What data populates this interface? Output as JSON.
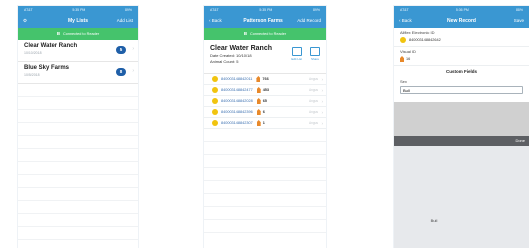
{
  "screen1": {
    "status": {
      "carrier": "AT&T",
      "time": "5:35 PM",
      "battery": "89%"
    },
    "nav": {
      "title": "My Lists",
      "right": "Add List"
    },
    "reader": "Connected to Reader",
    "lists": [
      {
        "name": "Clear Water Ranch",
        "date": "10/10/2018",
        "count": "5"
      },
      {
        "name": "Blue Sky Farms",
        "date": "10/5/2018",
        "count": "8"
      }
    ]
  },
  "screen2": {
    "status": {
      "carrier": "AT&T",
      "time": "5:35 PM",
      "battery": "89%"
    },
    "nav": {
      "left": "Back",
      "title": "Patterson Farms",
      "right": "Add Record"
    },
    "reader": "Connected to Reader",
    "farm": {
      "name": "Clear Water Ranch",
      "date_created": "Date Created: 10/10/18",
      "animal_count": "Animal Count: 5"
    },
    "actions": {
      "edit": "Edit List",
      "share": "Share"
    },
    "records": [
      {
        "eid": "840003148842011",
        "visual": "766",
        "right": "Angus"
      },
      {
        "eid": "840003148842477",
        "visual": "453",
        "right": "Angus"
      },
      {
        "eid": "840003148842028",
        "visual": "65",
        "right": "Angus"
      },
      {
        "eid": "840003148842396",
        "visual": "6",
        "right": "Angus"
      },
      {
        "eid": "840003148842307",
        "visual": "1",
        "right": "Angus"
      }
    ]
  },
  "screen3": {
    "status": {
      "carrier": "AT&T",
      "time": "5:36 PM",
      "battery": "88%"
    },
    "nav": {
      "left": "Back",
      "title": "New Record",
      "right": "Save"
    },
    "eid_label": "Allflex Electronic ID",
    "eid_value": "840003148842642",
    "visual_label": "Visual ID",
    "visual_value": "16",
    "custom_fields": "Custom Fields",
    "sex_label": "Sex",
    "sex_value": "Bull",
    "picker_done": "Done",
    "picker_option": "Bull"
  },
  "colors": {
    "nav_blue": "#3a97d2",
    "reader_green": "#45c36c",
    "badge_blue": "#1f5fa8",
    "tag_yellow": "#f1c40f",
    "tag_orange": "#e8892b"
  }
}
